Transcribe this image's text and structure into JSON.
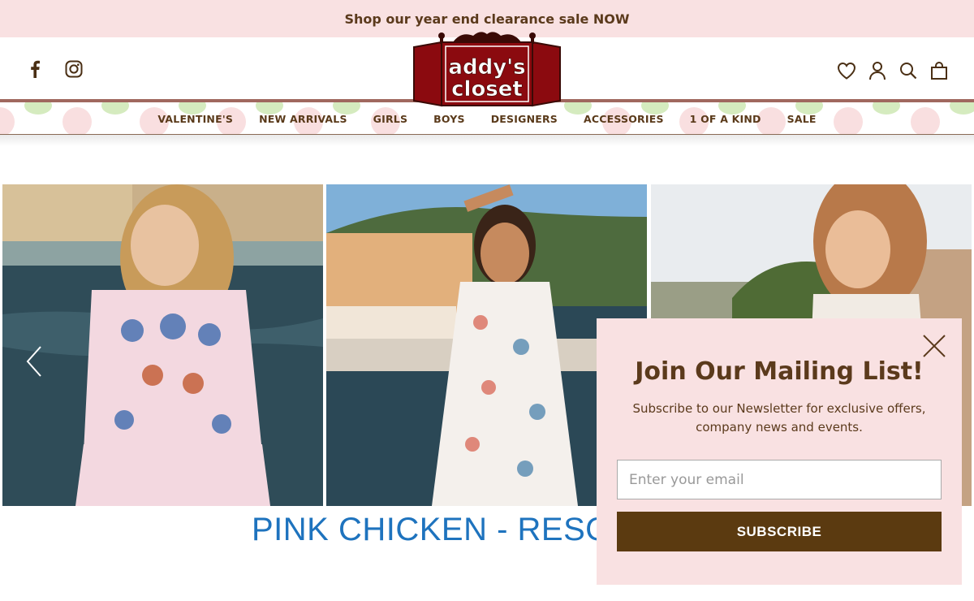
{
  "announcement": {
    "text": "Shop our year end clearance sale NOW"
  },
  "social": {
    "icons": [
      "facebook-icon",
      "instagram-icon"
    ]
  },
  "header_icons": [
    "heart-icon",
    "user-icon",
    "search-icon",
    "bag-icon"
  ],
  "logo": {
    "line1": "addy's",
    "line2": "closet"
  },
  "nav": {
    "items": [
      "VALENTINE'S",
      "NEW ARRIVALS",
      "GIRLS",
      "BOYS",
      "DESIGNERS",
      "ACCESSORIES",
      "1 OF A KIND",
      "SALE"
    ]
  },
  "hero": {
    "caption": "PINK CHICKEN - RESOF",
    "prev_icon": "chevron-left-icon"
  },
  "popup": {
    "title": "Join Our Mailing List!",
    "subtitle_line1": "Subscribe to our Newsletter for exclusive offers,",
    "subtitle_line2": "company news and events.",
    "email_placeholder": "Enter your email",
    "button_label": "SUBSCRIBE",
    "close_icon": "close-icon"
  },
  "colors": {
    "brand_brown": "#5b3a1c",
    "announce_bg": "#f9e1e2",
    "logo_red": "#8b0a0f",
    "caption_blue": "#1e73be"
  }
}
